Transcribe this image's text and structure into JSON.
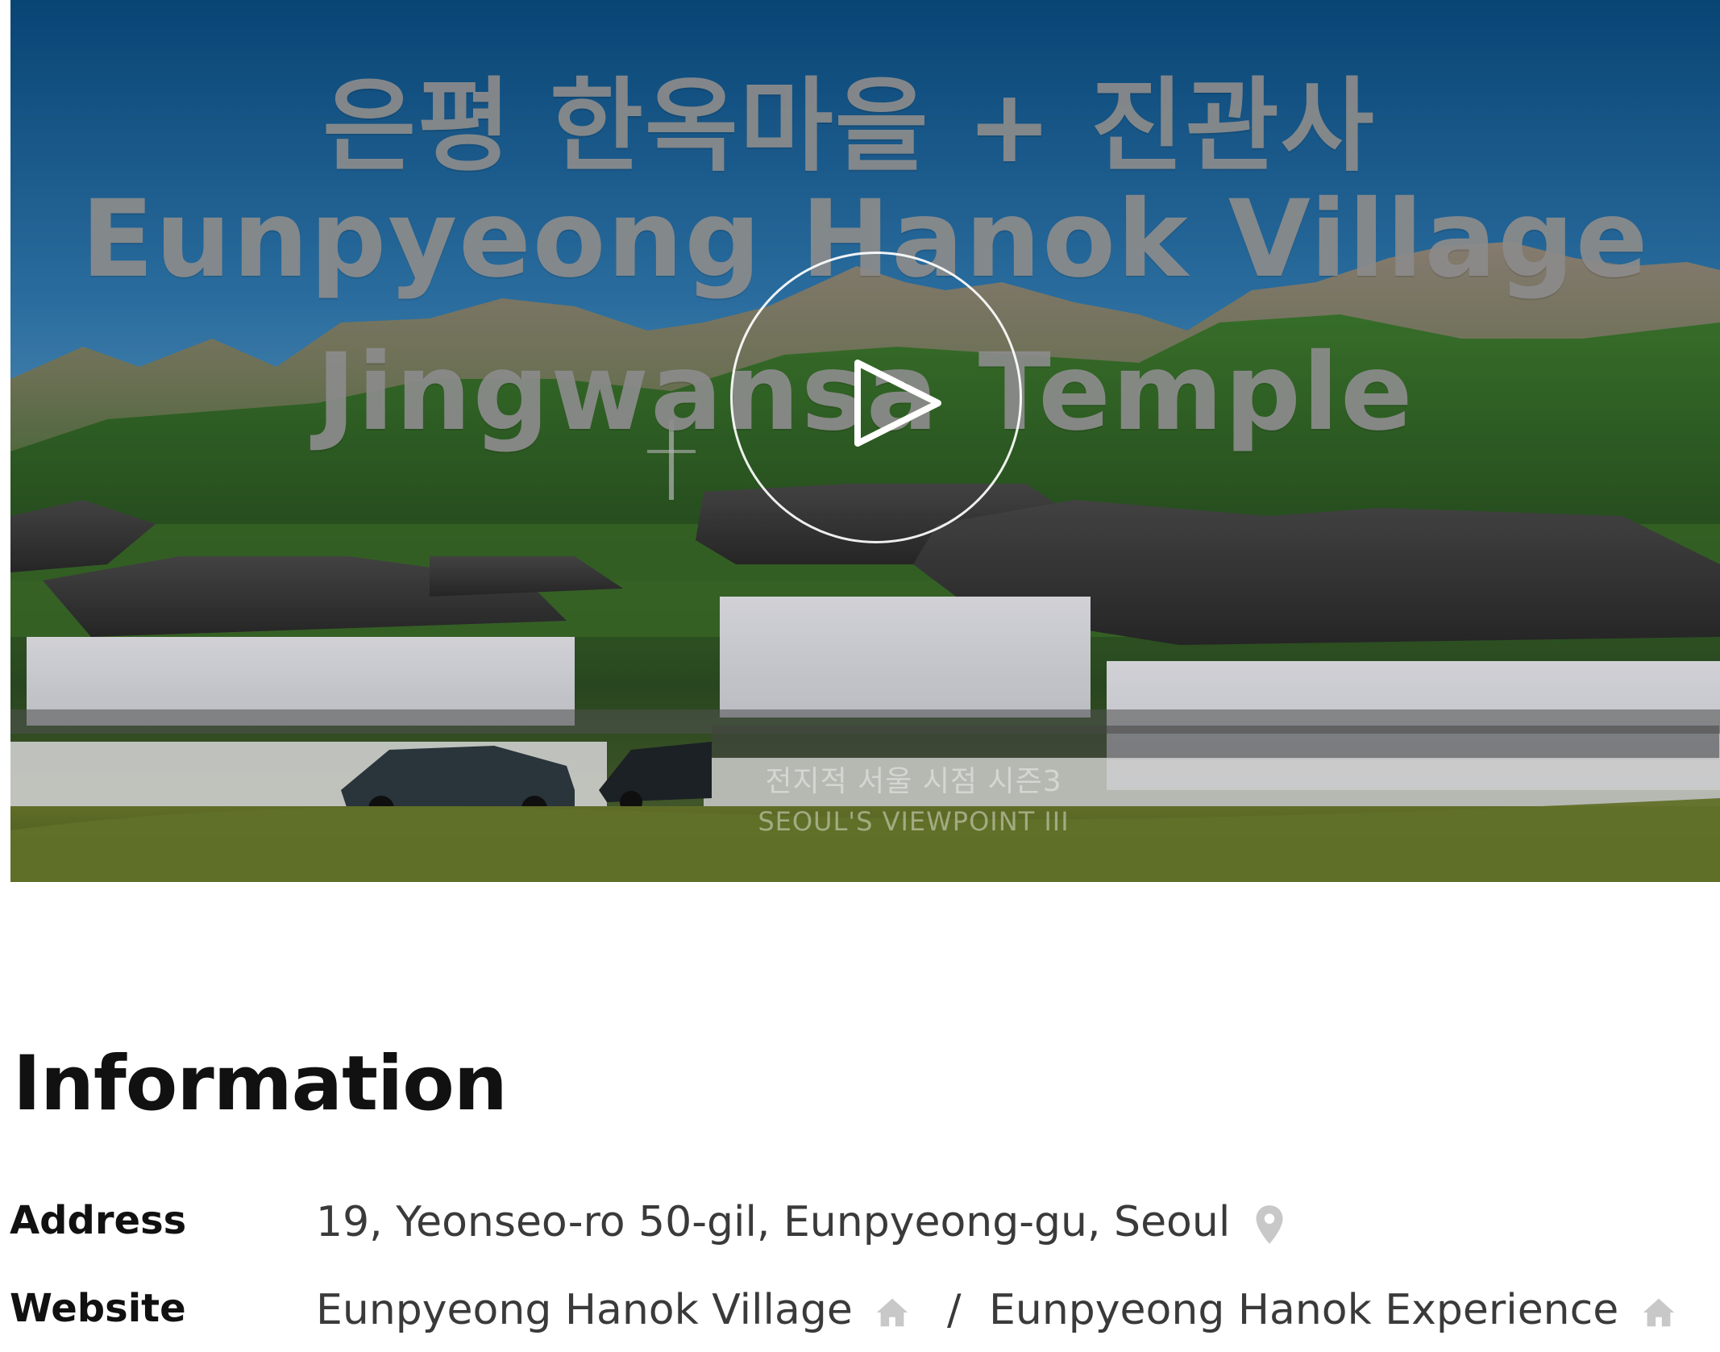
{
  "video": {
    "title_ko": "은평 한옥마을 + 진관사",
    "title_en_line1": "Eunpyeong Hanok Village",
    "title_en_line2": "Jingwansa Temple",
    "watermark_ko": "전지적 서울 시점 시즌3",
    "watermark_en": "SEOUL'S VIEWPOINT III",
    "play_icon": "play-icon"
  },
  "info": {
    "heading": "Information",
    "address_label": "Address",
    "address_value": "19, Yeonseo-ro 50-gil, Eunpyeong-gu, Seoul",
    "address_icon": "location-pin-icon",
    "website_label": "Website",
    "website_link1": "Eunpyeong Hanok Village",
    "website_separator": "/",
    "website_link2": "Eunpyeong Hanok Experience",
    "website_icon": "home-icon"
  },
  "colors": {
    "icon_gray": "#c8c8c8",
    "text_dark": "#111111",
    "text_body": "#3a3a3a"
  }
}
